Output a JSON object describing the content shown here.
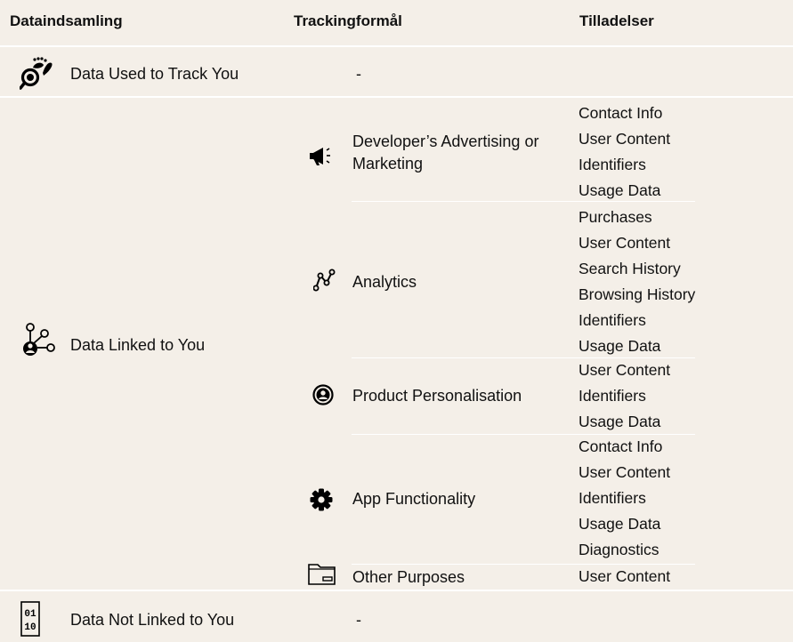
{
  "headers": {
    "col1": "Dataindsamling",
    "col2": "Trackingformål",
    "col3": "Tilladelser"
  },
  "rows": {
    "tracked": {
      "label": "Data Used to Track You",
      "purpose": "-"
    },
    "linked": {
      "label": "Data Linked to You",
      "purposes": [
        {
          "label": "Developer’s Advertising or Marketing",
          "icon": "megaphone-icon",
          "permissions": [
            "Contact Info",
            "User Content",
            "Identifiers",
            "Usage Data"
          ]
        },
        {
          "label": "Analytics",
          "icon": "analytics-icon",
          "permissions": [
            "Purchases",
            "User Content",
            "Search History",
            "Browsing History",
            "Identifiers",
            "Usage Data"
          ]
        },
        {
          "label": "Product Personalisation",
          "icon": "user-circle-icon",
          "permissions": [
            "User Content",
            "Identifiers",
            "Usage Data"
          ]
        },
        {
          "label": "App Functionality",
          "icon": "gear-icon",
          "permissions": [
            "Contact Info",
            "User Content",
            "Identifiers",
            "Usage Data",
            "Diagnostics"
          ]
        },
        {
          "label": "Other Purposes",
          "icon": "folder-icon",
          "permissions": [
            "User Content"
          ]
        }
      ]
    },
    "not_linked": {
      "label": "Data Not Linked to You",
      "purpose": "-"
    }
  }
}
